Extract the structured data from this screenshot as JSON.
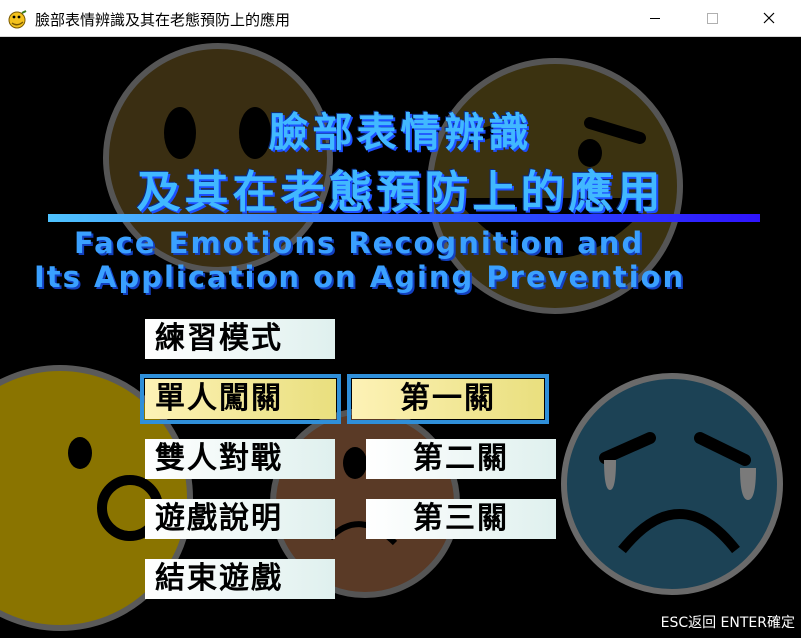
{
  "window": {
    "title": "臉部表情辨識及其在老態預防上的應用",
    "app_icon": "python-snake-icon",
    "controls": {
      "minimize": "minimize-icon",
      "maximize": "maximize-icon",
      "close": "close-icon"
    }
  },
  "header": {
    "title_cn_line1": "臉部表情辨識",
    "title_cn_line2": "及其在老態預防上的應用",
    "title_en_line1": "Face Emotions Recognition and",
    "title_en_line2": "Its Application on Aging Prevention"
  },
  "menu": {
    "main_items": [
      {
        "label": "練習模式",
        "selected": false
      },
      {
        "label": "單人闖關",
        "selected": true
      },
      {
        "label": "雙人對戰",
        "selected": false
      },
      {
        "label": "遊戲說明",
        "selected": false
      },
      {
        "label": "結束遊戲",
        "selected": false
      }
    ],
    "stage_items": [
      {
        "label": "第一關",
        "selected": true
      },
      {
        "label": "第二關",
        "selected": false
      },
      {
        "label": "第三關",
        "selected": false
      }
    ]
  },
  "footer": {
    "hint": "ESC返回 ENTER確定"
  },
  "colors": {
    "title_cn": "#41b8ff",
    "title_en": "#3aa0ff",
    "rule_start": "#4fc3ff",
    "rule_end": "#2f14ff",
    "button_bg": "#ffffff",
    "button_selected_bg": "#f3e89a",
    "selection_frame": "#2f8fd9"
  },
  "decorations": [
    "laughing-face-icon",
    "neutral-face-icon",
    "surprised-face-icon",
    "crying-face-icon"
  ]
}
